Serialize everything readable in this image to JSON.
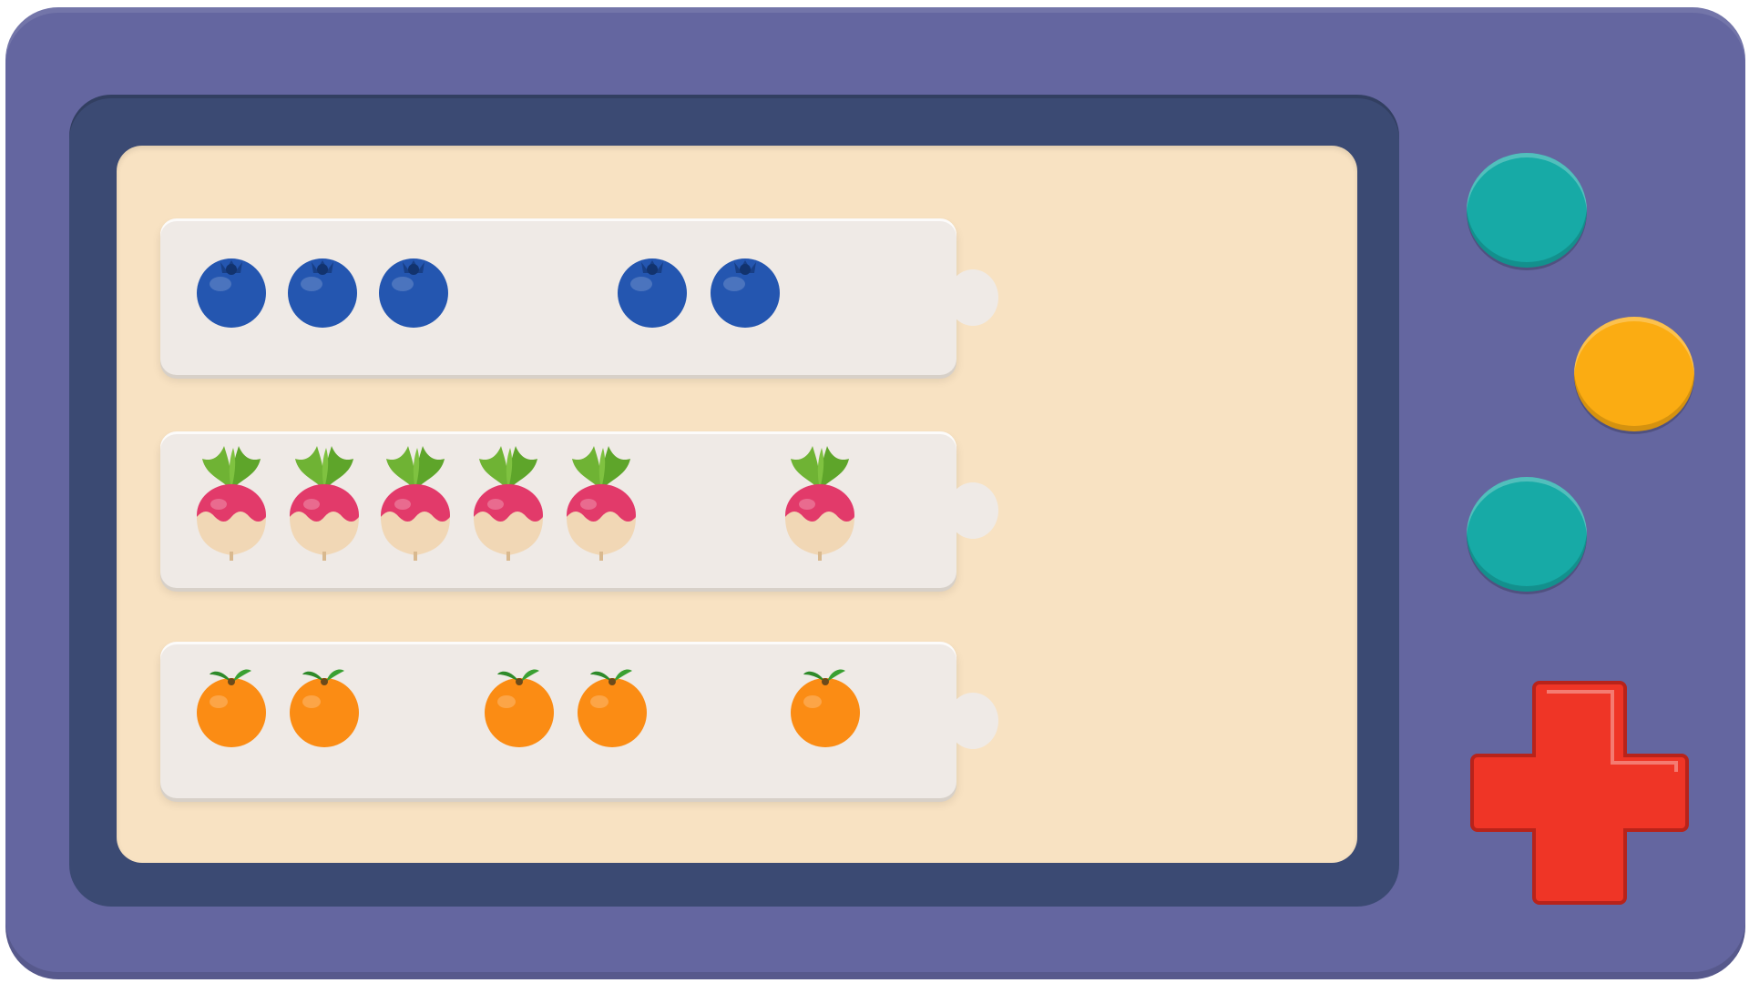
{
  "colors": {
    "console": "#6466a0",
    "bezel": "#3b4a73",
    "screen": "#f8e2c2",
    "strip": "#efeae6",
    "teal_button": "#17aaa6",
    "amber_button": "#fbac12",
    "dpad": "#ef3526"
  },
  "rows": [
    {
      "item": "blueberry-icon",
      "slots": [
        1,
        1,
        1,
        0,
        1,
        1,
        0,
        0,
        0
      ]
    },
    {
      "item": "radish-icon",
      "slots": [
        1,
        1,
        1,
        1,
        1,
        0,
        0,
        1,
        0
      ]
    },
    {
      "item": "orange-icon",
      "slots": [
        1,
        1,
        0,
        1,
        1,
        0,
        0,
        1,
        0
      ]
    }
  ],
  "controls": {
    "buttons": [
      "teal-button",
      "amber-button",
      "teal-button"
    ],
    "dpad": "dpad-cross"
  }
}
